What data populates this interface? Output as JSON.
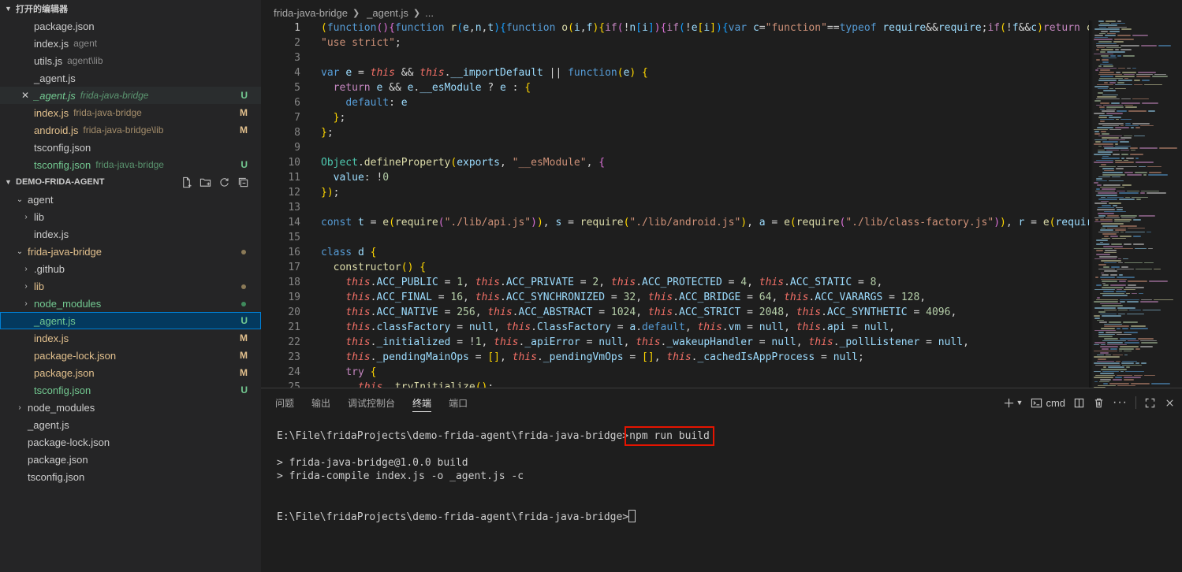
{
  "open_editors": {
    "title": "打开的编辑器",
    "items": [
      {
        "name": "package.json",
        "desc": "",
        "badge": "",
        "kind": "normal"
      },
      {
        "name": "index.js",
        "desc": "agent",
        "badge": "",
        "kind": "normal"
      },
      {
        "name": "utils.js",
        "desc": "agent\\lib",
        "badge": "",
        "kind": "normal"
      },
      {
        "name": "_agent.js",
        "desc": "",
        "badge": "",
        "kind": "normal"
      },
      {
        "name": "_agent.js",
        "desc": "frida-java-bridge",
        "badge": "U",
        "kind": "untracked-active"
      },
      {
        "name": "index.js",
        "desc": "frida-java-bridge",
        "badge": "M",
        "kind": "modified"
      },
      {
        "name": "android.js",
        "desc": "frida-java-bridge\\lib",
        "badge": "M",
        "kind": "modified"
      },
      {
        "name": "tsconfig.json",
        "desc": "",
        "badge": "",
        "kind": "normal"
      },
      {
        "name": "tsconfig.json",
        "desc": "frida-java-bridge",
        "badge": "U",
        "kind": "untracked"
      }
    ]
  },
  "explorer": {
    "title": "DEMO-FRIDA-AGENT",
    "tree": [
      {
        "depth": 1,
        "type": "folder-open",
        "name": "agent",
        "kind": "normal",
        "badge": ""
      },
      {
        "depth": 2,
        "type": "folder",
        "name": "lib",
        "kind": "normal",
        "badge": ""
      },
      {
        "depth": 2,
        "type": "file",
        "name": "index.js",
        "kind": "normal",
        "badge": ""
      },
      {
        "depth": 1,
        "type": "folder-open",
        "name": "frida-java-bridge",
        "kind": "modified",
        "badge": "dot-mod"
      },
      {
        "depth": 2,
        "type": "folder",
        "name": ".github",
        "kind": "normal",
        "badge": ""
      },
      {
        "depth": 2,
        "type": "folder",
        "name": "lib",
        "kind": "modified",
        "badge": "dot-mod"
      },
      {
        "depth": 2,
        "type": "folder",
        "name": "node_modules",
        "kind": "untracked",
        "badge": "dot-untr"
      },
      {
        "depth": 2,
        "type": "file",
        "name": "_agent.js",
        "kind": "untracked-selected",
        "badge": "U"
      },
      {
        "depth": 2,
        "type": "file",
        "name": "index.js",
        "kind": "modified",
        "badge": "M"
      },
      {
        "depth": 2,
        "type": "file",
        "name": "package-lock.json",
        "kind": "modified",
        "badge": "M"
      },
      {
        "depth": 2,
        "type": "file",
        "name": "package.json",
        "kind": "modified",
        "badge": "M"
      },
      {
        "depth": 2,
        "type": "file",
        "name": "tsconfig.json",
        "kind": "untracked",
        "badge": "U"
      },
      {
        "depth": 1,
        "type": "folder",
        "name": "node_modules",
        "kind": "normal",
        "badge": ""
      },
      {
        "depth": 1,
        "type": "file",
        "name": "_agent.js",
        "kind": "normal",
        "badge": ""
      },
      {
        "depth": 1,
        "type": "file",
        "name": "package-lock.json",
        "kind": "normal",
        "badge": ""
      },
      {
        "depth": 1,
        "type": "file",
        "name": "package.json",
        "kind": "normal",
        "badge": ""
      },
      {
        "depth": 1,
        "type": "file",
        "name": "tsconfig.json",
        "kind": "normal",
        "badge": ""
      }
    ],
    "icons": [
      "new-file-icon",
      "new-folder-icon",
      "refresh-icon",
      "collapse-all-icon"
    ]
  },
  "breadcrumb": [
    "frida-java-bridge",
    "_agent.js",
    "..."
  ],
  "code_lines": [
    "(function(){function r(e,n,t){function o(i,f){if(!n[i]){if(!e[i]){var c=\"function\"==typeof require&&require;if(!f&&c)return c(",
    "\"use strict\";",
    "",
    "var e = this && this.__importDefault || function(e) {",
    "  return e && e.__esModule ? e : {",
    "    default: e",
    "  };",
    "};",
    "",
    "Object.defineProperty(exports, \"__esModule\", {",
    "  value: !0",
    "});",
    "",
    "const t = e(require(\"./lib/api.js\")), s = require(\"./lib/android.js\"), a = e(require(\"./lib/class-factory.js\")), r = e(require",
    "",
    "class d {",
    "  constructor() {",
    "    this.ACC_PUBLIC = 1, this.ACC_PRIVATE = 2, this.ACC_PROTECTED = 4, this.ACC_STATIC = 8,",
    "    this.ACC_FINAL = 16, this.ACC_SYNCHRONIZED = 32, this.ACC_BRIDGE = 64, this.ACC_VARARGS = 128,",
    "    this.ACC_NATIVE = 256, this.ACC_ABSTRACT = 1024, this.ACC_STRICT = 2048, this.ACC_SYNTHETIC = 4096,",
    "    this.classFactory = null, this.ClassFactory = a.default, this.vm = null, this.api = null,",
    "    this._initialized = !1, this._apiError = null, this._wakeupHandler = null, this._pollListener = null,",
    "    this._pendingMainOps = [], this._pendingVmOps = [], this._cachedIsAppProcess = null;",
    "    try {",
    "      this._tryInitialize();"
  ],
  "panel": {
    "tabs": [
      "问题",
      "输出",
      "调试控制台",
      "终端",
      "端口"
    ],
    "active_tab": "终端",
    "shell_label": "cmd"
  },
  "terminal": {
    "prompt": "E:\\File\\fridaProjects\\demo-frida-agent\\frida-java-bridge>",
    "command": "npm run build",
    "output": [
      "> frida-java-bridge@1.0.0 build",
      "> frida-compile index.js -o _agent.js -c"
    ]
  },
  "colors": {
    "modified": "#e2c08d",
    "untracked": "#73c991",
    "highlight_box": "#e51400",
    "selection": "#04395e"
  }
}
